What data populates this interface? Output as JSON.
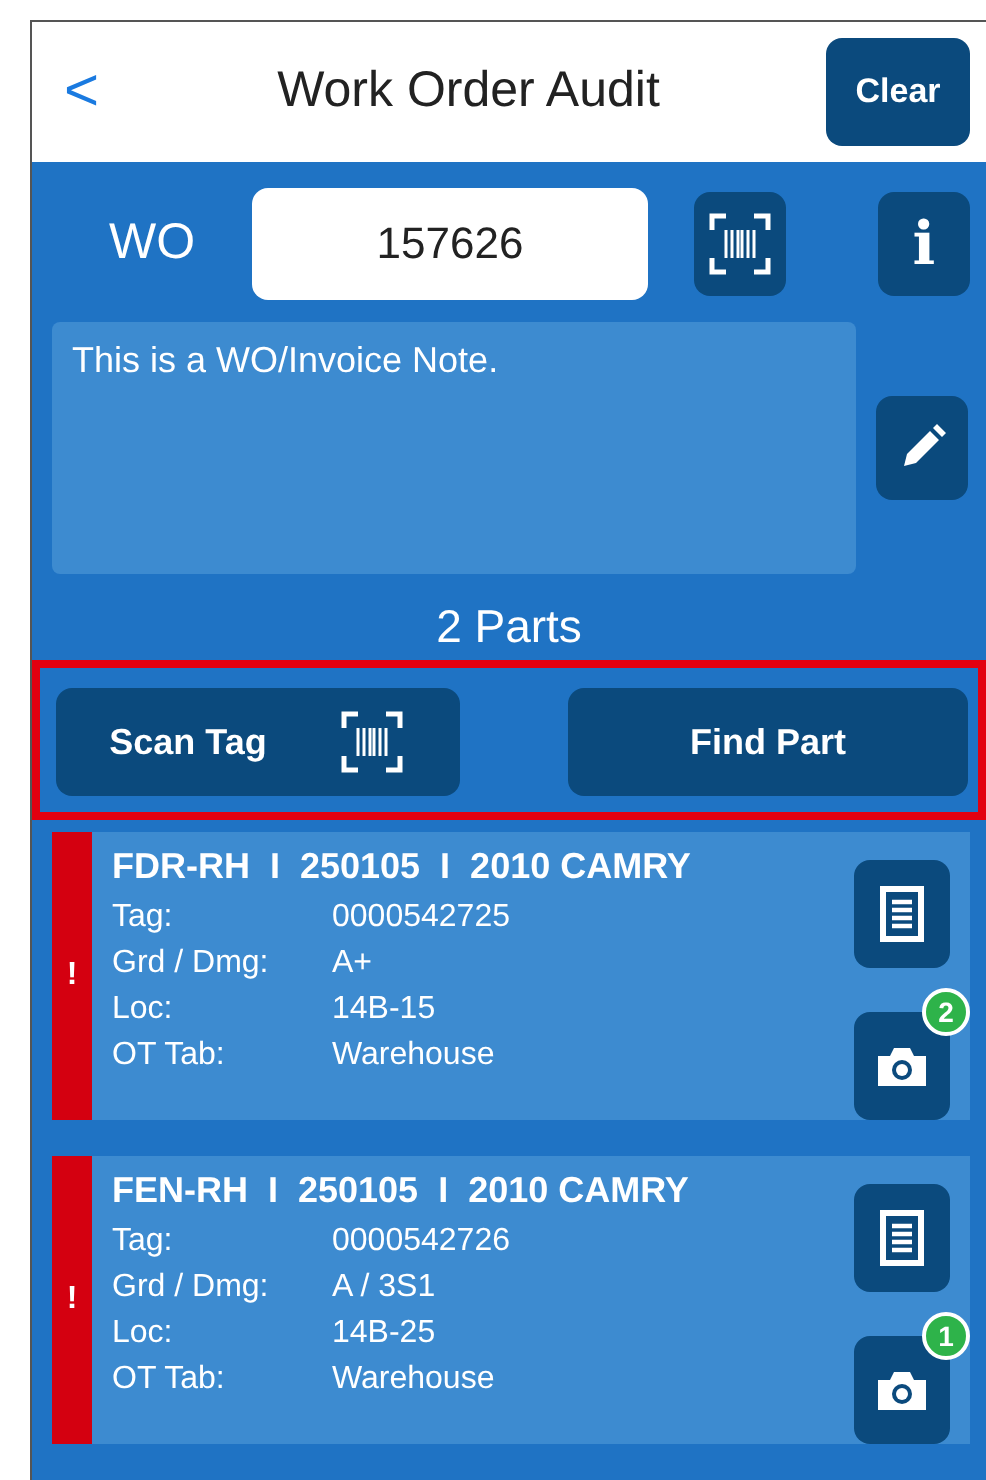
{
  "header": {
    "back": "<",
    "title": "Work Order Audit",
    "clear_button": "Clear"
  },
  "work_order": {
    "label": "WO",
    "value": "157626",
    "info_button": "i"
  },
  "note": {
    "value": "This is a WO/Invoice Note."
  },
  "parts_count": "2 Parts",
  "actions": {
    "scan_tag": "Scan Tag",
    "find_part": "Find Part"
  },
  "parts": [
    {
      "title": "FDR-RH  I  250105  I  2010 CAMRY",
      "alert": true,
      "alert_mark": "!",
      "photo_count": "2",
      "fields": [
        {
          "label": "Tag:",
          "value": "0000542725"
        },
        {
          "label": "Grd / Dmg:",
          "value": "A+"
        },
        {
          "label": "Loc:",
          "value": "14B-15"
        },
        {
          "label": "OT Tab:",
          "value": "Warehouse"
        }
      ]
    },
    {
      "title": "FEN-RH  I  250105  I  2010 CAMRY",
      "alert": true,
      "alert_mark": "!",
      "photo_count": "1",
      "fields": [
        {
          "label": "Tag:",
          "value": "0000542726"
        },
        {
          "label": "Grd / Dmg:",
          "value": "A / 3S1"
        },
        {
          "label": "Loc:",
          "value": "14B-25"
        },
        {
          "label": "OT Tab:",
          "value": "Warehouse"
        }
      ]
    }
  ]
}
